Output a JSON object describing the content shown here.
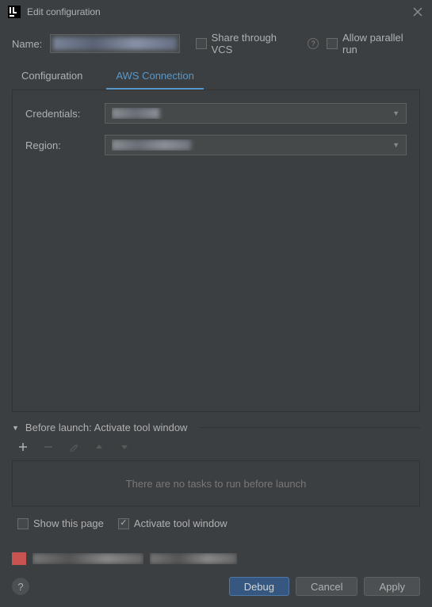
{
  "title": "Edit configuration",
  "name_label": "Name:",
  "share_vcs_label": "Share through VCS",
  "allow_parallel_label": "Allow parallel run",
  "tabs": {
    "configuration": "Configuration",
    "aws_connection": "AWS Connection"
  },
  "form": {
    "credentials_label": "Credentials:",
    "region_label": "Region:"
  },
  "before_launch": {
    "header": "Before launch: Activate tool window",
    "empty_text": "There are no tasks to run before launch"
  },
  "checkboxes": {
    "show_page": "Show this page",
    "activate_tool": "Activate tool window"
  },
  "buttons": {
    "debug": "Debug",
    "cancel": "Cancel",
    "apply": "Apply"
  }
}
